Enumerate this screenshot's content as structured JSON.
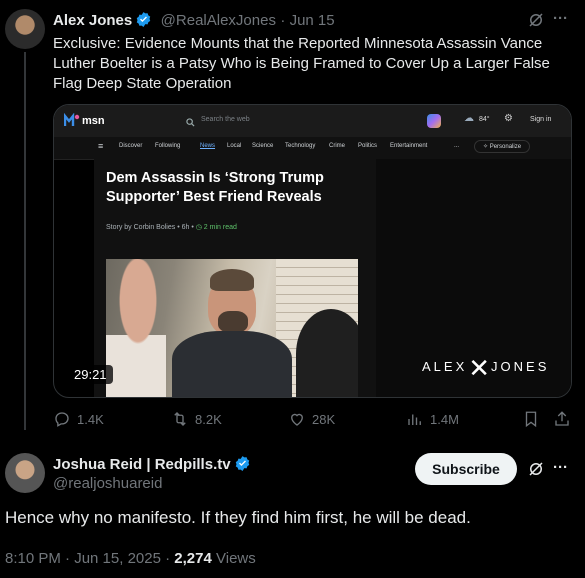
{
  "tweet": {
    "author_name": "Alex Jones",
    "handle": "@RealAlexJones",
    "date": "· Jun 15",
    "text_lines": [
      "Exclusive: Evidence Mounts that the Reported Minnesota Assassin Vance",
      "Luther Boelter is a Patsy Who is Being Framed to Cover Up a Larger False",
      "Flag Deep State Operation"
    ],
    "more_label": "···"
  },
  "media": {
    "msn_logo": "msn",
    "search_placeholder": "Search the web",
    "weather": "84°",
    "signin": "Sign in",
    "nav": [
      "Discover",
      "Following",
      "News",
      "Local",
      "Science",
      "Technology",
      "Crime",
      "Politics",
      "Entertainment",
      "...",
      "Personalize"
    ],
    "headline": "Dem Assassin Is ‘Strong Trump Supporter’ Best Friend Reveals",
    "byline_prefix": "Story by Corbin Bolies • 6h •",
    "read_time": "2 min read",
    "duration": "29:21",
    "brand_left": "ALEX",
    "brand_right": "JONES"
  },
  "actions": {
    "replies": "1.4K",
    "reposts": "8.2K",
    "likes": "28K",
    "views": "1.4M"
  },
  "reply": {
    "author_name": "Joshua Reid | Redpills.tv",
    "handle": "@realjoshuareid",
    "subscribe_label": "Subscribe",
    "more_label": "···",
    "text": "Hence why no manifesto. If they find him first, he will be dead.",
    "timestamp": "8:10 PM · Jun 15, 2025 ·",
    "view_count": "2,274",
    "views_label": "Views"
  },
  "colors": {
    "background": "#000000",
    "verified_blue": "#1d9bf0",
    "muted_text": "#71767b"
  }
}
